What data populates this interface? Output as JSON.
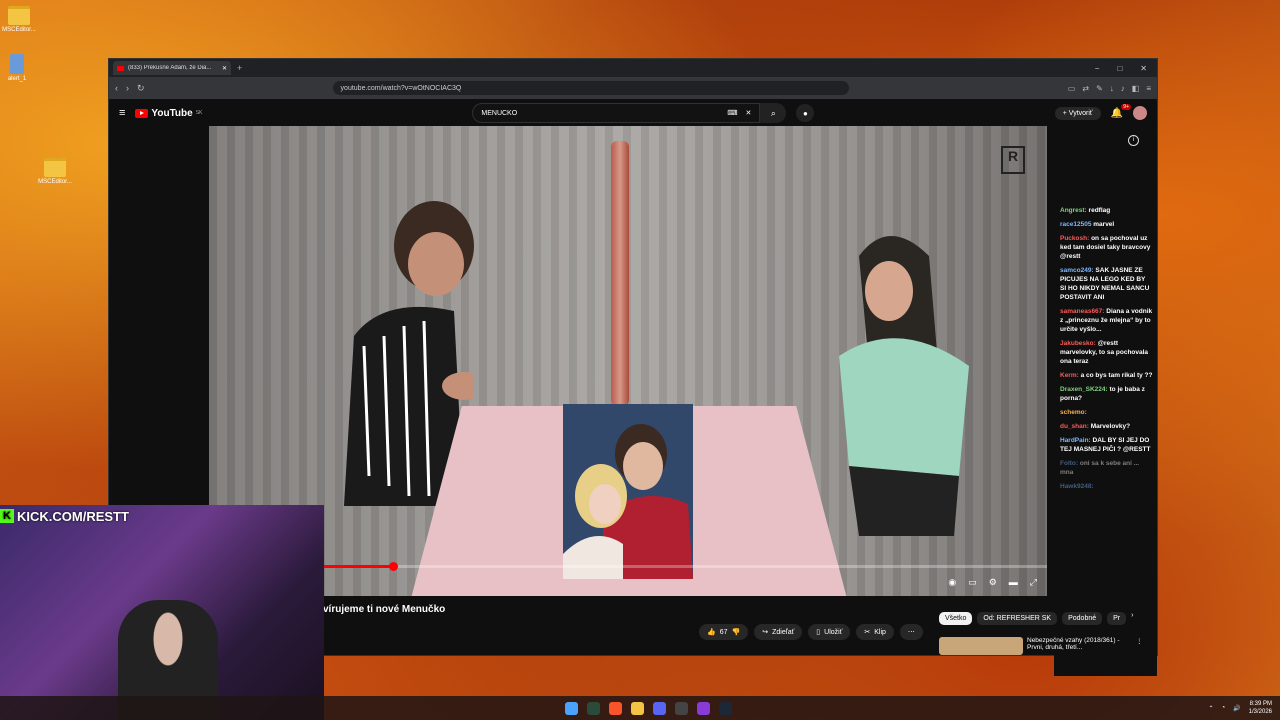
{
  "desktop": {
    "icons": [
      {
        "label": "MSCEditor...",
        "icon": "folder-icon"
      },
      {
        "label": "alert_1",
        "icon": "recycle-icon"
      },
      {
        "label": "MSCEditor...",
        "icon": "zip-folder-icon"
      }
    ]
  },
  "browser": {
    "tab_title": "(833) Prekusne Adam, že Dia...",
    "url": "youtube.com/watch?v=wOtNOCIAC3Q",
    "window_controls": [
      "−",
      "□",
      "✕"
    ]
  },
  "youtube": {
    "logo": "YouTube",
    "logo_region": "SK",
    "search_value": "MENUCKO",
    "create_label": "Vytvoriť",
    "notification_badge": "9+",
    "video_title": "vírujeme ti nové Menučko",
    "progress_fraction": 0.22,
    "actions": {
      "likes": "67",
      "share": "Zdieľať",
      "save": "Uložiť",
      "clip": "Klip"
    },
    "chips": [
      "Všetko",
      "Od: REFRESHER SK",
      "Podobné",
      "Pr"
    ],
    "related": [
      {
        "title": "Nebezpečné vzahy (2018/361) - Prvni, druhá, třetí..."
      }
    ]
  },
  "chat": {
    "messages": [
      {
        "user": "Angrest:",
        "text": "redflag",
        "color": "g"
      },
      {
        "user": "race12505",
        "text": "marvel",
        "color": "u"
      },
      {
        "user": "Puckosh:",
        "text": "on sa pochoval uz ked tam dosiel taky bravcovy @restt",
        "color": "r"
      },
      {
        "user": "samco249:",
        "text": "SAK JASNE ZE PICUJES NA LEGO KED BY SI HO NIKDY NEMAL SANCU POSTAVIT ANI",
        "color": "u"
      },
      {
        "user": "samaneas667:",
        "text": "Diana a vodnik z „princeznu že mlejna“ by to určite vyšlo...",
        "color": "r"
      },
      {
        "user": "Jakubesko:",
        "text": "@restt marvelovky, to sa pochovala ona teraz",
        "color": "r"
      },
      {
        "user": "Kerm:",
        "text": "a co bys tam rikal ty ??",
        "color": "r"
      },
      {
        "user": "Draxen_SK224:",
        "text": "to je baba z porna?",
        "color": "g"
      },
      {
        "user": "schemo:",
        "text": "",
        "color": "o"
      },
      {
        "user": "du_shan:",
        "text": "Marvelovky?",
        "color": "r"
      },
      {
        "user": "HardPain:",
        "text": "DAL BY SI JEJ DO TEJ MASNEJ PIČI ? @RESTT",
        "color": "u"
      },
      {
        "user": "Folto:",
        "text": "oni sa k sebe ani ... mna",
        "color": "u",
        "dim": true
      },
      {
        "user": "Hawk9248:",
        "text": "",
        "color": "u",
        "dim": true
      }
    ]
  },
  "overlay": {
    "kick_url": "KICK.COM/RESTT",
    "kick_k": "K"
  },
  "taskbar": {
    "time": "8:39 PM",
    "date": "1/3/2026"
  }
}
